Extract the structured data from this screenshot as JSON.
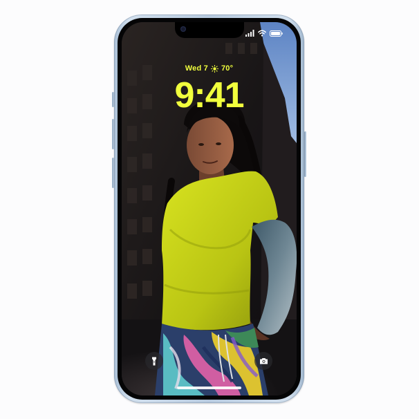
{
  "lock_screen": {
    "date": "Wed 7",
    "weather_icon": "sun-icon",
    "temperature": "70°",
    "time": "9:41"
  },
  "status_bar": {
    "icons": [
      "cellular-signal-icon",
      "wifi-icon",
      "battery-icon"
    ]
  },
  "quick_actions": {
    "left": "flashlight-icon",
    "right": "camera-icon"
  },
  "colors": {
    "clock_accent": "#f1ff3d",
    "device_finish": "#b7cadf",
    "shirt": "#c7d219"
  }
}
